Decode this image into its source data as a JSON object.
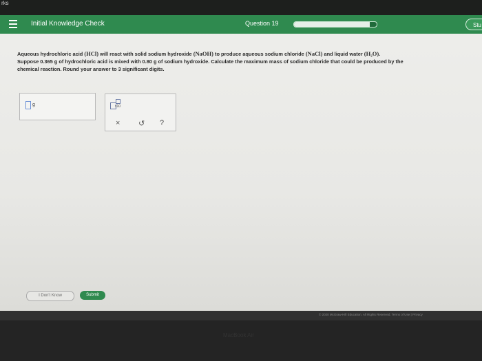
{
  "bezel_mark": "rks",
  "header": {
    "title": "Initial Knowledge Check",
    "question_label": "Question 19",
    "progress_fraction": 0.92,
    "study_label": "Stu"
  },
  "question": {
    "line1_parts": [
      "Aqueous hydrochloric acid ",
      "(HCl)",
      " will react with solid sodium hydroxide ",
      "(NaOH)",
      " to produce aqueous sodium chloride ",
      "(NaCl)",
      " and liquid water ",
      "(H₂O)",
      "."
    ],
    "line2": "Suppose 0.365 g of hydrochloric acid is mixed with 0.80 g of sodium hydroxide. Calculate the maximum mass of sodium chloride that could be produced by the",
    "line3": "chemical reaction. Round your answer to 3 significant digits."
  },
  "answer": {
    "value": "",
    "unit": "g"
  },
  "toolbar": {
    "x10_label": "x10",
    "clear": "×",
    "undo": "↺",
    "help": "?"
  },
  "buttons": {
    "dont_know": "I Don't Know",
    "submit": "Submit"
  },
  "footer": {
    "text": "© 2020 McGraw-Hill Education. All Rights Reserved.   Terms of Use  |  Privacy"
  },
  "device_label": "MacBook Air",
  "colors": {
    "brand_green": "#2f8a4f"
  }
}
